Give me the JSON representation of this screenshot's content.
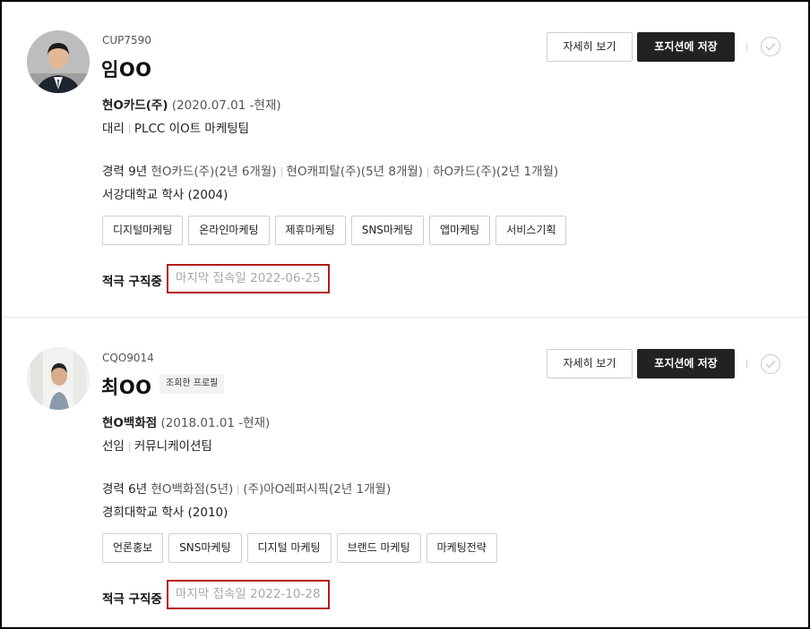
{
  "candidates": [
    {
      "code": "CUP7590",
      "name": "임OO",
      "badge": "",
      "current_company": "현O카드(주)",
      "current_period": "(2020.07.01 -현재)",
      "position": "대리",
      "team": "PLCC 이O트 마케팅팀",
      "career_label": "경력 9년",
      "career_items": [
        "현O카드(주)(2년 6개월)",
        "현O캐피탈(주)(5년 8개월)",
        "하O카드(주)(2년 1개월)"
      ],
      "education": "서강대학교 학사 (2004)",
      "tags": [
        "디지털마케팅",
        "온라인마케팅",
        "제휴마케팅",
        "SNS마케팅",
        "앱마케팅",
        "서비스기획"
      ],
      "status": "적극 구직중",
      "last_login": "마지막 접속일 2022-06-25"
    },
    {
      "code": "CQO9014",
      "name": "최OO",
      "badge": "조회한 프로필",
      "current_company": "현O백화점",
      "current_period": "(2018.01.01 -현재)",
      "position": "선임",
      "team": "커뮤니케이션팀",
      "career_label": "경력 6년",
      "career_items": [
        "현O백화점(5년)",
        "(주)아O레퍼시픽(2년 1개월)"
      ],
      "education": "경희대학교 학사 (2010)",
      "tags": [
        "언론홍보",
        "SNS마케팅",
        "디지털 마케팅",
        "브랜드 마케팅",
        "마케팅전략"
      ],
      "status": "적극 구직중",
      "last_login": "마지막 접속일 2022-10-28"
    }
  ],
  "actions": {
    "detail_label": "자세히 보기",
    "save_label": "포지션에 저장"
  },
  "icons": {
    "select": "check-circle-icon",
    "avatar": "avatar-photo"
  },
  "colors": {
    "primary_button": "#222222",
    "highlight_border": "#b31b1b",
    "muted_text": "#a8a8a8"
  }
}
